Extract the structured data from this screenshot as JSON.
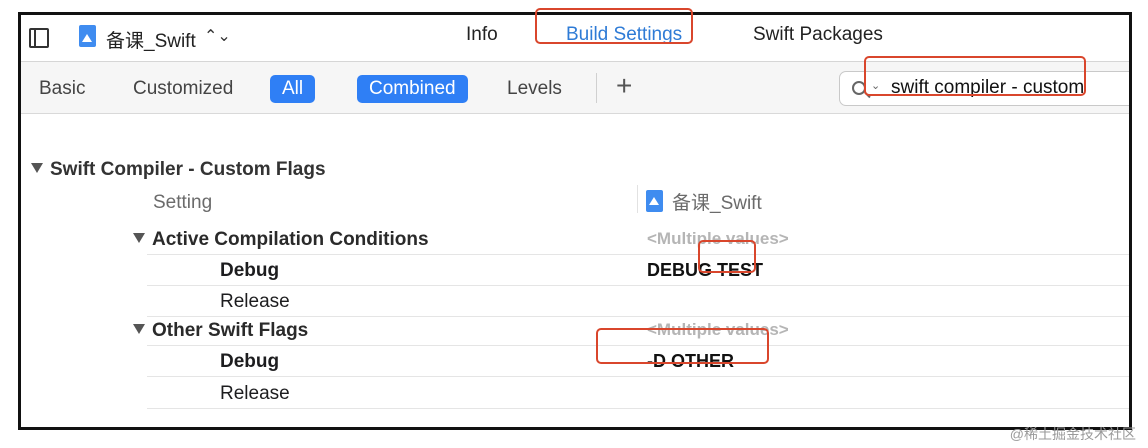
{
  "header": {
    "target_name": "备课_Swift",
    "tabs": [
      "Info",
      "Build Settings",
      "Swift Packages"
    ]
  },
  "filter": {
    "buttons": [
      "Basic",
      "Customized",
      "All",
      "Combined",
      "Levels"
    ],
    "selected": [
      "All",
      "Combined"
    ],
    "add_label": "+",
    "search_value": "swift compiler - custom"
  },
  "section": {
    "title": "Swift Compiler - Custom Flags",
    "setting_col": "Setting",
    "target_col": "备课_Swift"
  },
  "rows": [
    {
      "label": "Active Compilation Conditions",
      "value": "<Multiple values>"
    },
    {
      "label": "Debug",
      "value": "DEBUG TEST"
    },
    {
      "label": "Release",
      "value": ""
    },
    {
      "label": "Other Swift Flags",
      "value": "<Multiple values>"
    },
    {
      "label": "Debug",
      "value": "-D OTHER"
    },
    {
      "label": "Release",
      "value": ""
    }
  ],
  "watermark": "@稀土掘金技术社区",
  "colors": {
    "accent": "#2f7ff5",
    "highlight": "#d9462c"
  }
}
